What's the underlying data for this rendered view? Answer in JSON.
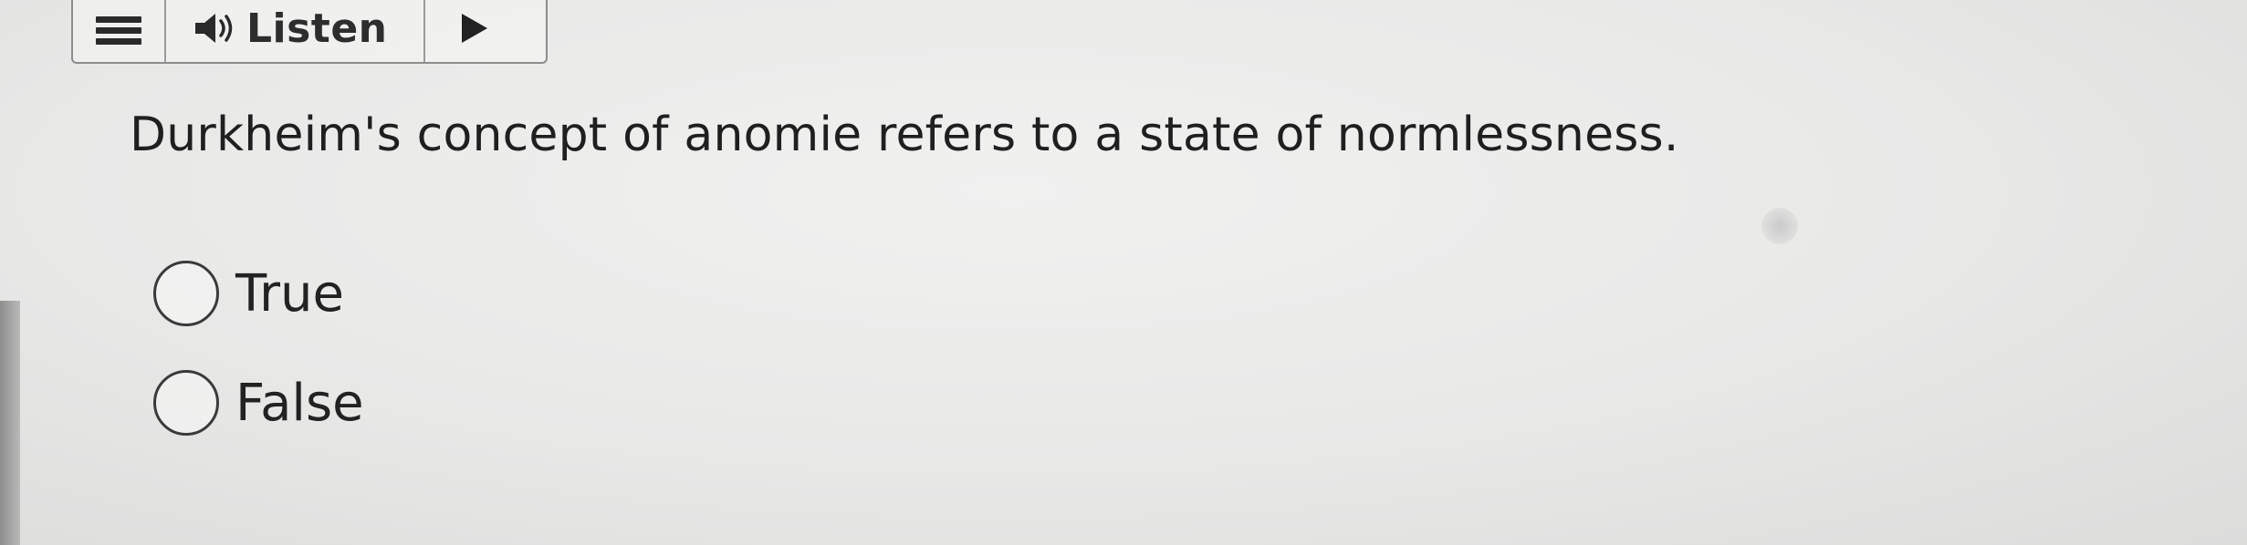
{
  "toolbar": {
    "menu_icon": "hamburger-icon",
    "speaker_icon": "speaker-icon",
    "listen_label": "Listen",
    "play_icon": "play-icon"
  },
  "question": {
    "text": "Durkheim's concept of anomie refers to a state of normlessness."
  },
  "options": [
    {
      "label": "True",
      "selected": false
    },
    {
      "label": "False",
      "selected": false
    }
  ],
  "colors": {
    "text": "#1f1f1f",
    "border": "#8d8d8d",
    "background": "#ebebea"
  }
}
